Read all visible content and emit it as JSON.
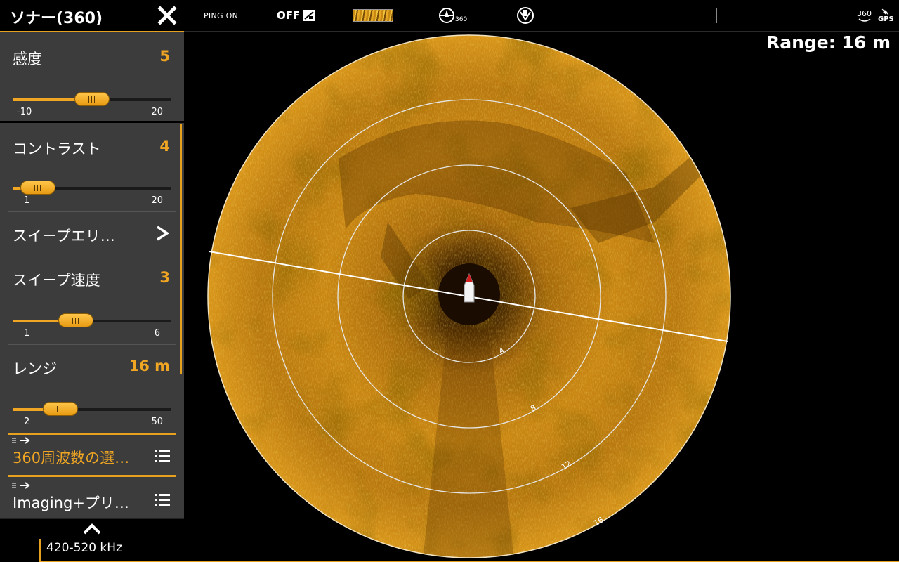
{
  "panel": {
    "title": "ソナー(360)",
    "items": [
      {
        "label": "感度",
        "value": "5",
        "min": "-10",
        "max": "20",
        "fraction": 0.5
      },
      {
        "label": "コントラスト",
        "value": "4",
        "min": "1",
        "max": "20",
        "fraction": 0.16
      },
      {
        "label": "スイープエリ…",
        "type": "submenu"
      },
      {
        "label": "スイープ速度",
        "value": "3",
        "min": "1",
        "max": "6",
        "fraction": 0.4
      },
      {
        "label": "レンジ",
        "value": "16 m",
        "min": "2",
        "max": "50",
        "fraction": 0.3
      },
      {
        "label": "360周波数の選…",
        "type": "list"
      },
      {
        "label": "Imaging+プリ…",
        "type": "list"
      }
    ]
  },
  "topbar": {
    "ping": "PING ON",
    "off": "OFF",
    "compass_360": "360",
    "status_360": "360",
    "status_gps": "GPS"
  },
  "sonar": {
    "range": "Range: 16 m",
    "frequency": "420-520 kHz",
    "ring_labels": [
      "4",
      "8",
      "12",
      "16"
    ]
  },
  "colors": {
    "accent": "#e6a21f",
    "panel_bg": "#3c3c3c",
    "sonar_dark": "#5a3300",
    "sonar_bright": "#e8a21d"
  },
  "icons": [
    "close-icon",
    "compass-360-icon",
    "heading-icon",
    "gps-icon",
    "list-icon",
    "chevron-up-icon",
    "chevron-right-icon"
  ]
}
